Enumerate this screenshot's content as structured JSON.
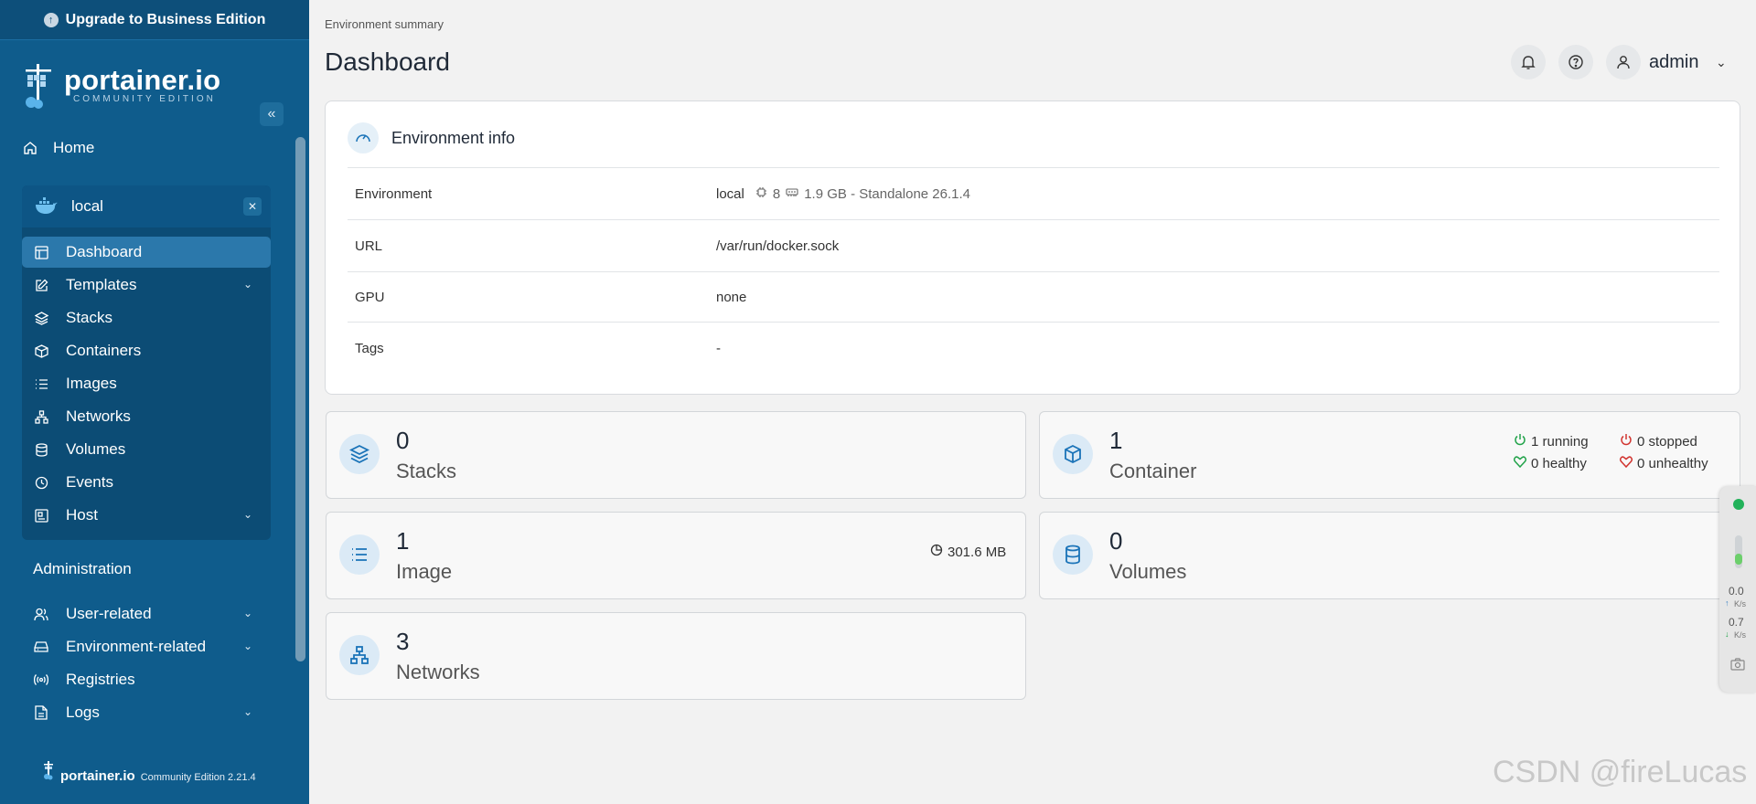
{
  "sidebar": {
    "upgrade_label": "Upgrade to Business Edition",
    "logo_title": "portainer.io",
    "logo_subtitle": "COMMUNITY EDITION",
    "home_label": "Home",
    "environment": {
      "name": "local",
      "items": [
        {
          "label": "Dashboard",
          "icon": "dashboard-icon",
          "active": true
        },
        {
          "label": "Templates",
          "icon": "edit-icon",
          "expandable": true
        },
        {
          "label": "Stacks",
          "icon": "layers-icon"
        },
        {
          "label": "Containers",
          "icon": "box-icon"
        },
        {
          "label": "Images",
          "icon": "list-icon"
        },
        {
          "label": "Networks",
          "icon": "network-icon"
        },
        {
          "label": "Volumes",
          "icon": "database-icon"
        },
        {
          "label": "Events",
          "icon": "clock-icon"
        },
        {
          "label": "Host",
          "icon": "host-icon",
          "expandable": true
        }
      ]
    },
    "admin_title": "Administration",
    "admin_items": [
      {
        "label": "User-related",
        "icon": "users-icon",
        "expandable": true
      },
      {
        "label": "Environment-related",
        "icon": "drive-icon",
        "expandable": true
      },
      {
        "label": "Registries",
        "icon": "radio-icon"
      },
      {
        "label": "Logs",
        "icon": "file-icon",
        "expandable": true
      }
    ],
    "footer_brand": "portainer.io",
    "footer_edition": "Community Edition 2.21.4"
  },
  "header": {
    "breadcrumb": "Environment summary",
    "title": "Dashboard",
    "user": "admin"
  },
  "env_info": {
    "title": "Environment info",
    "rows": {
      "environment_label": "Environment",
      "environment_name": "local",
      "cpu": "8",
      "memory_detail": "1.9 GB - Standalone 26.1.4",
      "url_label": "URL",
      "url_value": "/var/run/docker.sock",
      "gpu_label": "GPU",
      "gpu_value": "none",
      "tags_label": "Tags",
      "tags_value": "-"
    }
  },
  "stats": {
    "stacks": {
      "count": "0",
      "label": "Stacks"
    },
    "container": {
      "count": "1",
      "label": "Container",
      "running": "1 running",
      "stopped": "0 stopped",
      "healthy": "0 healthy",
      "unhealthy": "0 unhealthy"
    },
    "image": {
      "count": "1",
      "label": "Image",
      "size": "301.6 MB"
    },
    "volumes": {
      "count": "0",
      "label": "Volumes"
    },
    "networks": {
      "count": "3",
      "label": "Networks"
    }
  },
  "widget": {
    "up_value": "0.0",
    "up_unit": "K/s",
    "down_value": "0.7",
    "down_unit": "K/s"
  },
  "colors": {
    "sidebar": "#0f5c8c",
    "accent": "#1a73b8",
    "running": "#22a34a",
    "stopped": "#d1342f"
  },
  "watermark": "CSDN @fireLucas"
}
